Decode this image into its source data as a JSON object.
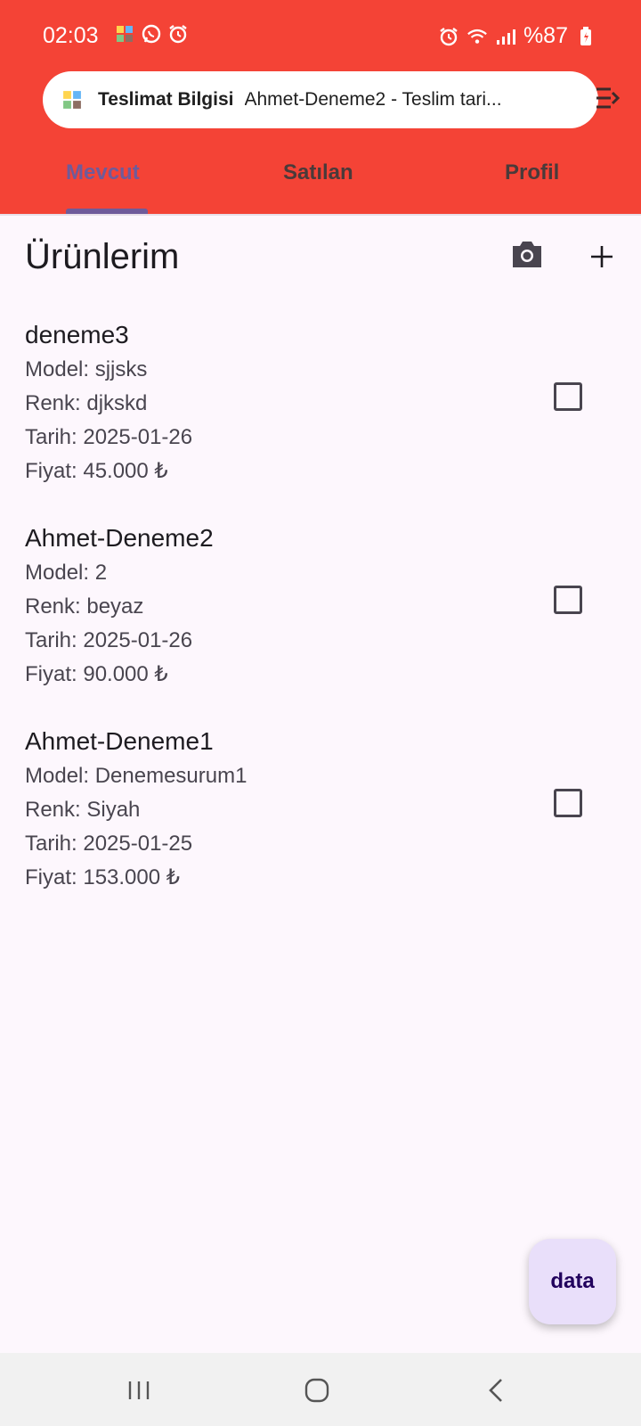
{
  "status_bar": {
    "time": "02:03",
    "battery": "%87",
    "left_icons": [
      "app-notification-icon",
      "whatsapp-icon",
      "alarm-icon"
    ],
    "right_icons": [
      "alarm-icon",
      "wifi-icon",
      "signal-icon",
      "battery-charging-icon"
    ]
  },
  "notification": {
    "title": "Teslimat Bilgisi",
    "body": "Ahmet-Deneme2 - Teslim tari..."
  },
  "tabs": [
    {
      "label": "Mevcut",
      "active": true
    },
    {
      "label": "Satılan",
      "active": false
    },
    {
      "label": "Profil",
      "active": false
    }
  ],
  "page": {
    "title": "Ürünlerim"
  },
  "products": [
    {
      "name": "deneme3",
      "model": "Model: sjjsks",
      "color": "Renk: djkskd",
      "date": "Tarih: 2025-01-26",
      "price": "Fiyat: 45.000 ₺",
      "checked": false
    },
    {
      "name": "Ahmet-Deneme2",
      "model": "Model: 2",
      "color": "Renk: beyaz",
      "date": "Tarih: 2025-01-26",
      "price": "Fiyat: 90.000 ₺",
      "checked": false
    },
    {
      "name": "Ahmet-Deneme1",
      "model": "Model: Denemesurum1",
      "color": "Renk: Siyah",
      "date": "Tarih: 2025-01-25",
      "price": "Fiyat: 153.000 ₺",
      "checked": false
    }
  ],
  "fab": {
    "label": "data"
  },
  "colors": {
    "app_bar": "#f44336",
    "active_tab": "#6f5b9a",
    "background": "#fdf7fd",
    "fab": "#e9dffa"
  }
}
